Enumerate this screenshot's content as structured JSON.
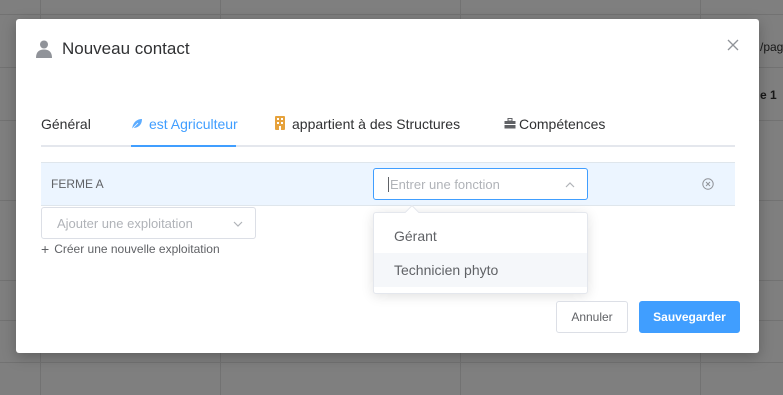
{
  "background": {
    "text_top_right": "/pag",
    "text_right_mid": "e 1"
  },
  "modal": {
    "title": "Nouveau contact",
    "tabs": [
      {
        "label": "Général",
        "icon": "none"
      },
      {
        "label": "est Agriculteur",
        "icon": "leaf-icon",
        "active": true
      },
      {
        "label": "appartient à des Structures",
        "icon": "building-icon"
      },
      {
        "label": "Compétences",
        "icon": "toolbox-icon"
      }
    ],
    "row": {
      "label": "FERME A",
      "function_placeholder": "Entrer une fonction"
    },
    "exploitation": {
      "placeholder": "Ajouter une exploitation",
      "create_label": "Créer une nouvelle exploitation"
    },
    "dropdown": {
      "options": [
        "Gérant",
        "Technicien phyto"
      ]
    },
    "buttons": {
      "cancel": "Annuler",
      "save": "Sauvegarder"
    }
  },
  "colors": {
    "accent": "#409eff",
    "row_bg": "#ecf5ff",
    "building_icon": "#e6a23c"
  }
}
